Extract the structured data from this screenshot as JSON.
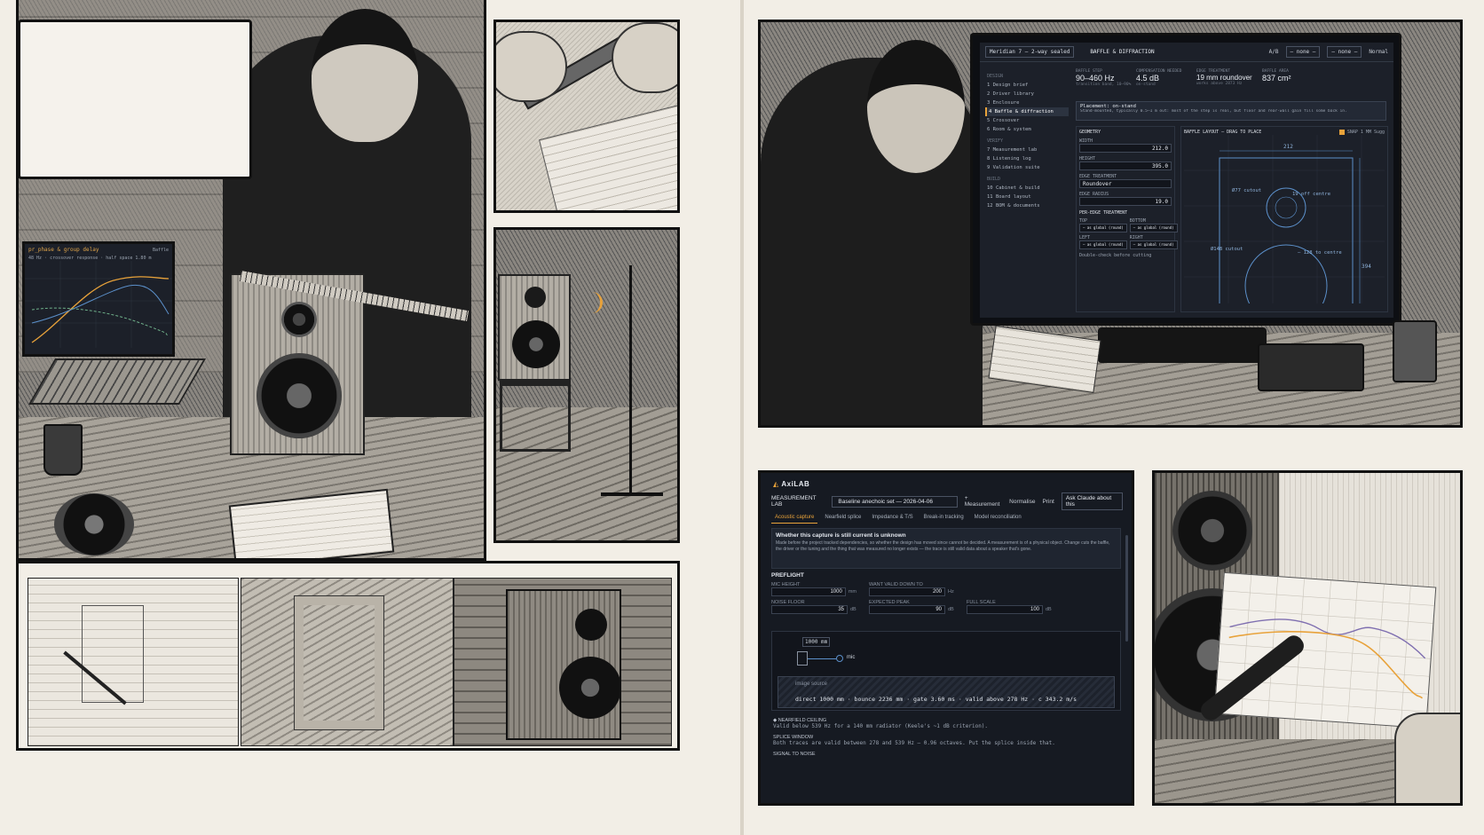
{
  "laptop": {
    "header": "pr_phase & group delay",
    "subheader": "48 Hz · crossover response · half space 1.80 m",
    "tab": "Baffle"
  },
  "monitor": {
    "project_select": "Meridian 7 — 2-way sealed",
    "section_title": "BAFFLE & DIFFRACTION",
    "ab_label": "A/B",
    "ab_a": "— none —",
    "ab_b": "— none —",
    "normal_label": "Normal",
    "sidebar": {
      "group_design": "DESIGN",
      "group_verify": "VERIFY",
      "group_build": "BUILD",
      "items": [
        {
          "num": "1",
          "label": "Design brief"
        },
        {
          "num": "2",
          "label": "Driver library"
        },
        {
          "num": "3",
          "label": "Enclosure"
        },
        {
          "num": "4",
          "label": "Baffle & diffraction"
        },
        {
          "num": "5",
          "label": "Crossover"
        },
        {
          "num": "6",
          "label": "Room & system"
        },
        {
          "num": "7",
          "label": "Measurement lab"
        },
        {
          "num": "8",
          "label": "Listening log"
        },
        {
          "num": "9",
          "label": "Validation suite"
        },
        {
          "num": "10",
          "label": "Cabinet & build"
        },
        {
          "num": "11",
          "label": "Board layout"
        },
        {
          "num": "12",
          "label": "BOM & documents"
        }
      ]
    },
    "stats": [
      {
        "label": "BAFFLE STEP",
        "value": "90–460 Hz",
        "extra": "transition band, 10–90%"
      },
      {
        "label": "COMPENSATION NEEDED",
        "value": "4.5 dB",
        "extra": "on-stand"
      },
      {
        "label": "EDGE TREATMENT",
        "value": "19 mm roundover",
        "extra": "works above 2873 Hz"
      },
      {
        "label": "BAFFLE AREA",
        "value": "837 cm²",
        "extra": ""
      }
    ],
    "placement_title": "Placement: on-stand",
    "placement_text": "Stand-mounted, typically 0.5–1 m out: most of the step is real, but floor and rear-wall gain fill some back in.",
    "geometry": {
      "title": "GEOMETRY",
      "width_label": "WIDTH",
      "width_value": "212.0",
      "height_label": "HEIGHT",
      "height_value": "395.0",
      "edge_treatment_label": "EDGE TREATMENT",
      "edge_treatment_value": "Roundover",
      "edge_radius_label": "EDGE RADIUS",
      "edge_radius_value": "19.0",
      "per_edge_title": "PER-EDGE TREATMENT",
      "top_label": "TOP",
      "bottom_label": "BOTTOM",
      "left_label": "LEFT",
      "right_label": "RIGHT",
      "edge_default": "— as global (round)",
      "footer": "Double-check before cutting"
    },
    "layout": {
      "title": "BAFFLE LAYOUT — DRAG TO PLACE",
      "snap_label": "SNAP 1 MM",
      "sugg_label": "Sugg",
      "dim_width": "212",
      "dim_height": "394",
      "tweeter_label": "Ø77 cutout",
      "tweeter_center": "19 off centre",
      "woofer_label": "Ø148 cutout",
      "woofer_offset": "— 128 to centre"
    }
  },
  "app": {
    "brand": "AxiLAB",
    "top_label": "MEASUREMENT LAB",
    "set_select": "Baseline anechoic set — 2026-04-06",
    "measurement_link": "+ Measurement",
    "normalise": "Normalise",
    "print": "Print",
    "ask": "Ask Claude about this",
    "tabs": [
      "Acoustic capture",
      "Nearfield splice",
      "Impedance & T/S",
      "Break-in tracking",
      "Model reconciliation"
    ],
    "warning_title": "Whether this capture is still current is unknown",
    "warning_text": "Made before the project tracked dependencies, so whether the design has moved since cannot be decided. A measurement is of a physical object. Change cuts the baffle, the driver or the tuning and the thing that was measured no longer exists — the trace is still valid data about a speaker that's gone.",
    "preflight": {
      "title": "PREFLIGHT",
      "mic_height_label": "MIC HEIGHT",
      "mic_height_value": "1000",
      "mic_height_unit": "mm",
      "want_valid_label": "WANT VALID DOWN TO",
      "want_valid_value": "200",
      "want_valid_unit": "Hz",
      "noise_floor_label": "NOISE FLOOR",
      "noise_floor_value": "35",
      "noise_floor_unit": "dB",
      "expected_peak_label": "EXPECTED PEAK",
      "expected_peak_value": "90",
      "expected_peak_unit": "dB",
      "full_scale_label": "FULL SCALE",
      "full_scale_value": "100",
      "full_scale_unit": "dB"
    },
    "diagram": {
      "distance": "1000 mm",
      "mic": "mic",
      "image_source": "image source"
    },
    "readout": "direct 1000 mm · bounce 2236 mm · gate 3.60 ms · valid above 278 Hz · c 343.2 m/s",
    "notes": [
      {
        "title": "NEARFIELD CEILING",
        "text": "Valid below 539 Hz for a 140 mm radiator (Keele's ~1 dB criterion)."
      },
      {
        "title": "SPLICE WINDOW",
        "text": "Both traces are valid between 278 and 539 Hz — 0.96 octaves. Put the splice inside that."
      },
      {
        "title": "SIGNAL TO NOISE",
        "text": ""
      }
    ]
  },
  "colors": {
    "accent": "#e8a23a",
    "screen_bg": "#1c2029",
    "panel_border": "#111111",
    "paper": "#f2eee6"
  }
}
